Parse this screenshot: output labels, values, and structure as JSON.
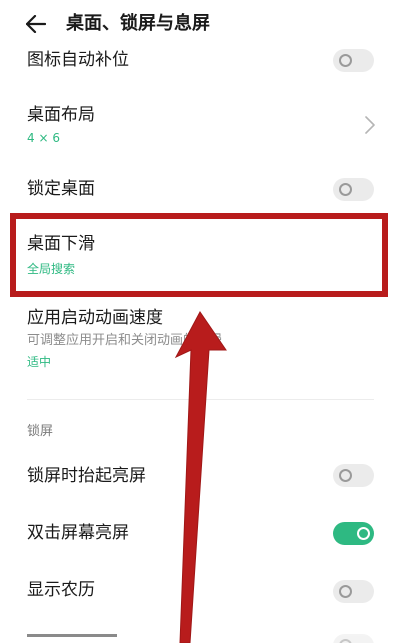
{
  "header": {
    "title": "桌面、锁屏与息屏",
    "back_icon": "arrow-left-icon"
  },
  "rows": {
    "icon_autofill": {
      "label": "图标自动补位",
      "toggle_on": false
    },
    "desktop_layout": {
      "label": "桌面布局",
      "value": "4 × 6"
    },
    "lock_desktop": {
      "label": "锁定桌面",
      "toggle_on": false
    },
    "desktop_swipe_down": {
      "label": "桌面下滑",
      "value": "全局搜索"
    },
    "app_anim_speed": {
      "label": "应用启动动画速度",
      "description": "可调整应用开启和关闭动画的快慢",
      "value": "适中"
    }
  },
  "lock_section": {
    "label": "锁屏",
    "rows": {
      "raise_to_wake": {
        "label": "锁屏时抬起亮屏",
        "toggle_on": false
      },
      "double_tap_wake": {
        "label": "双击屏幕亮屏",
        "toggle_on": true
      },
      "lunar_calendar": {
        "label": "显示农历",
        "toggle_on": false
      }
    }
  },
  "colors": {
    "accent": "#2eb982",
    "annotation_red": "#b81c1c"
  }
}
